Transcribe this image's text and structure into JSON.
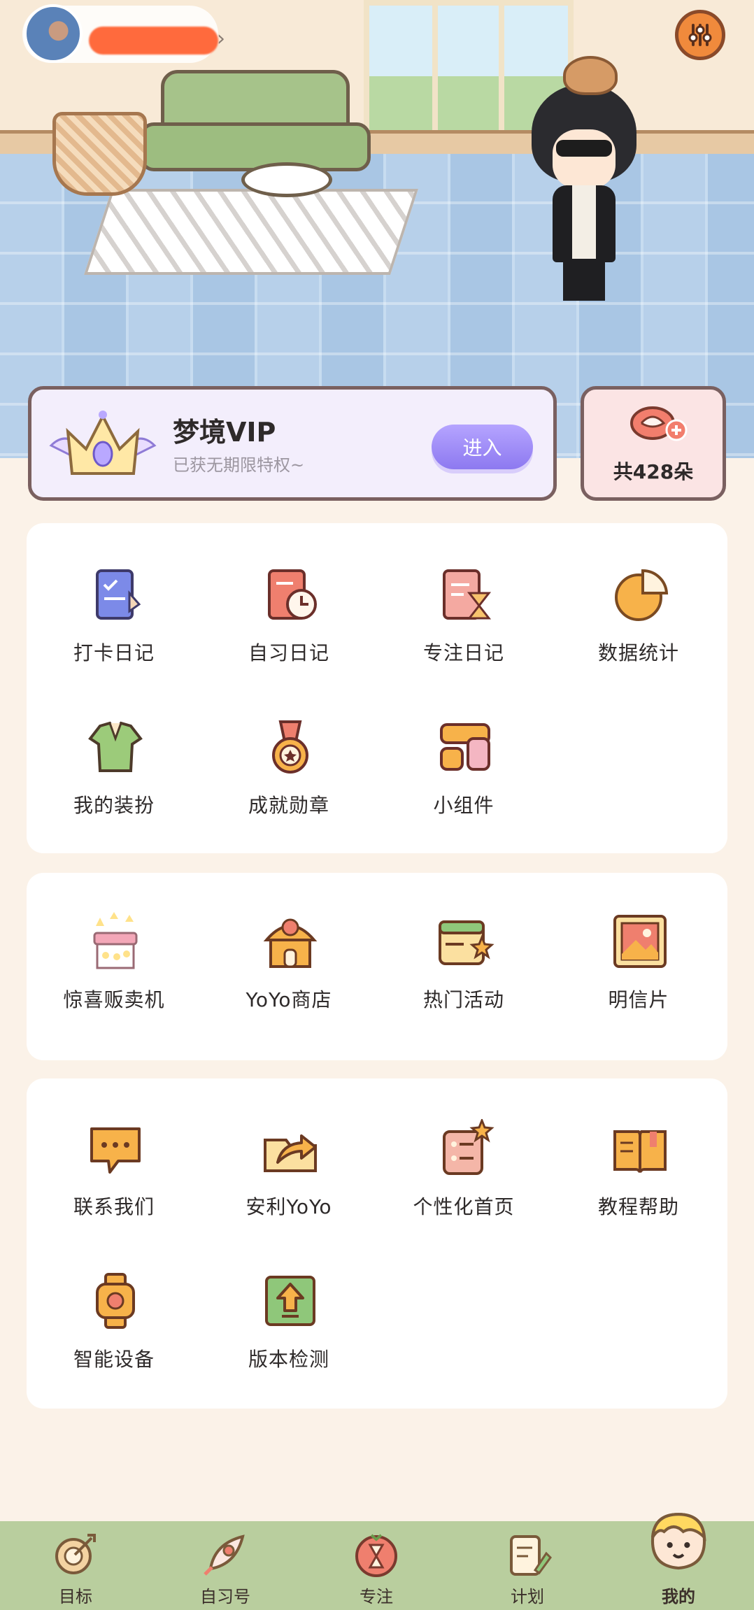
{
  "header": {
    "avatar_icon": "user-avatar",
    "settings_icon": "sliders-icon"
  },
  "vip": {
    "title": "梦境VIP",
    "subtitle": "已获无期限特权~",
    "button_label": "进入",
    "icon": "crown-icon"
  },
  "flowers": {
    "count_label": "共428朵",
    "icon": "add-flower-icon"
  },
  "section1": {
    "items": [
      {
        "label": "打卡日记",
        "icon": "checklist-diary-icon"
      },
      {
        "label": "自习日记",
        "icon": "study-diary-icon"
      },
      {
        "label": "专注日记",
        "icon": "hourglass-diary-icon"
      },
      {
        "label": "数据统计",
        "icon": "pie-chart-icon"
      },
      {
        "label": "我的装扮",
        "icon": "shirt-icon"
      },
      {
        "label": "成就勋章",
        "icon": "medal-icon"
      },
      {
        "label": "小组件",
        "icon": "widget-icon"
      }
    ]
  },
  "section2": {
    "items": [
      {
        "label": "惊喜贩卖机",
        "icon": "vending-machine-icon"
      },
      {
        "label": "YoYo商店",
        "icon": "shop-icon"
      },
      {
        "label": "热门活动",
        "icon": "calendar-star-icon"
      },
      {
        "label": "明信片",
        "icon": "postcard-icon"
      }
    ]
  },
  "section3": {
    "items": [
      {
        "label": "联系我们",
        "icon": "chat-icon"
      },
      {
        "label": "安利YoYo",
        "icon": "share-icon"
      },
      {
        "label": "个性化首页",
        "icon": "customize-icon"
      },
      {
        "label": "教程帮助",
        "icon": "book-icon"
      },
      {
        "label": "智能设备",
        "icon": "smartwatch-icon"
      },
      {
        "label": "版本检测",
        "icon": "update-icon"
      }
    ]
  },
  "tabbar": {
    "items": [
      {
        "label": "目标",
        "icon": "target-icon"
      },
      {
        "label": "自习号",
        "icon": "rocket-icon"
      },
      {
        "label": "专注",
        "icon": "focus-timer-icon"
      },
      {
        "label": "计划",
        "icon": "plan-icon"
      },
      {
        "label": "我的",
        "icon": "profile-icon"
      }
    ],
    "active": "我的"
  }
}
